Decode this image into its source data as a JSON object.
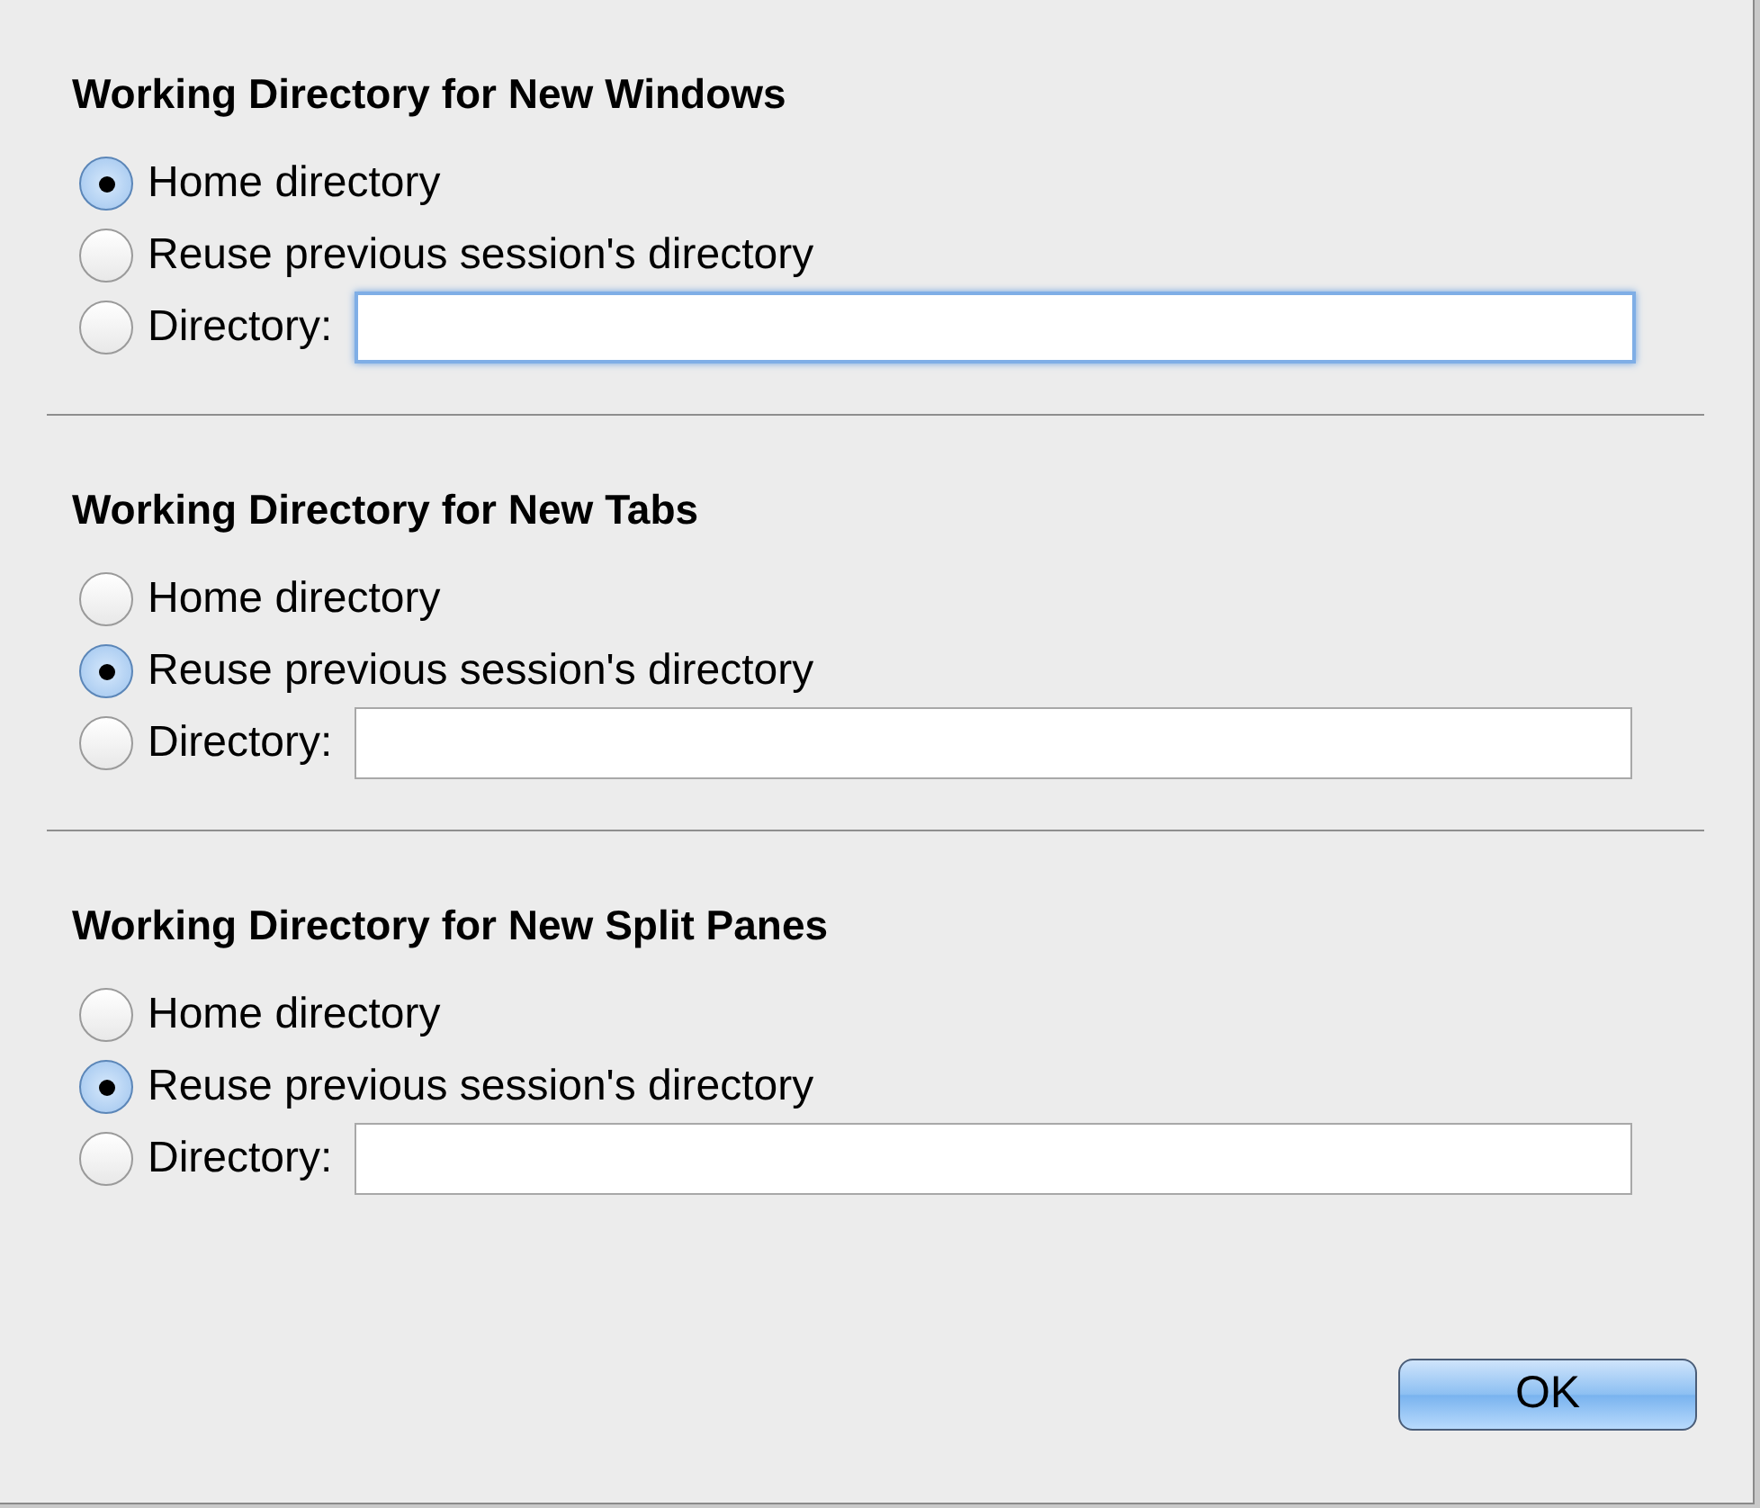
{
  "sections": [
    {
      "title": "Working Directory for New Windows",
      "options": [
        {
          "label": "Home directory",
          "selected": true
        },
        {
          "label": "Reuse previous session's directory",
          "selected": false
        },
        {
          "label": "Directory:",
          "selected": false,
          "kind": "field",
          "focused": true
        }
      ]
    },
    {
      "title": "Working Directory for New Tabs",
      "options": [
        {
          "label": "Home directory",
          "selected": false
        },
        {
          "label": "Reuse previous session's directory",
          "selected": true
        },
        {
          "label": "Directory:",
          "selected": false,
          "kind": "field",
          "focused": false
        }
      ]
    },
    {
      "title": "Working Directory for New Split Panes",
      "options": [
        {
          "label": "Home directory",
          "selected": false
        },
        {
          "label": "Reuse previous session's directory",
          "selected": true
        },
        {
          "label": "Directory:",
          "selected": false,
          "kind": "field",
          "focused": false
        }
      ]
    }
  ],
  "buttons": [
    {
      "label": "OK",
      "default": true
    }
  ]
}
